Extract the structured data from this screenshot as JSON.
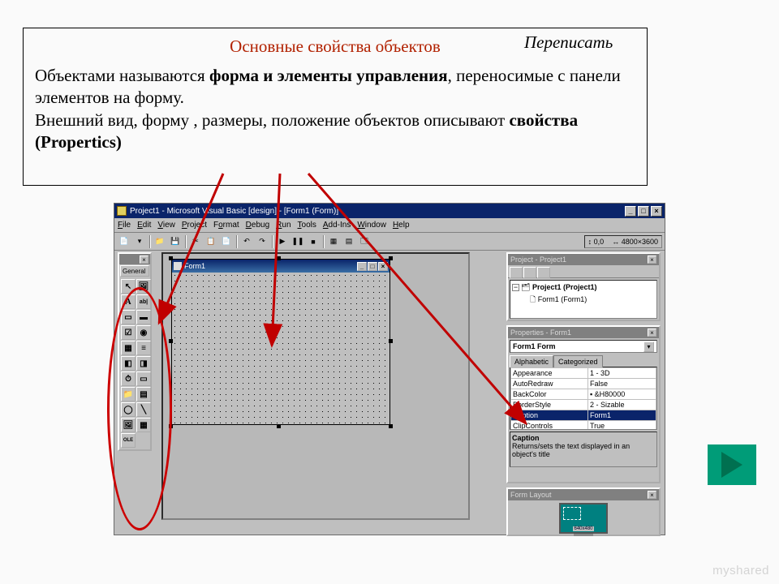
{
  "callout": {
    "heading": "Основные свойства объектов",
    "rewrite": "Переписать",
    "line1_pre": "Объектами называются ",
    "line1_bold": "форма и элементы управления",
    "line1_post": ", переносимые с панели элементов на форму.",
    "line2": "Внешний вид, форму , размеры, положение объектов описывают ",
    "line2_bold": "свойства (Propertics)"
  },
  "ide": {
    "title": "Project1 - Microsoft Visual Basic [design] - [Form1 (Form)]",
    "menubar": [
      "File",
      "Edit",
      "View",
      "Project",
      "Format",
      "Debug",
      "Run",
      "Tools",
      "Add-Ins",
      "Window",
      "Help"
    ],
    "toolbox_title": "",
    "toolbox_tab": "General",
    "form_title": "Form1",
    "project_panel": {
      "title": "Project - Project1",
      "root": "Project1 (Project1)",
      "child": "Form1 (Form1)"
    },
    "properties_panel": {
      "title": "Properties - Form1",
      "combo": "Form1 Form",
      "tabs": [
        "Alphabetic",
        "Categorized"
      ],
      "rows": [
        {
          "name": "Appearance",
          "value": "1 - 3D"
        },
        {
          "name": "AutoRedraw",
          "value": "False"
        },
        {
          "name": "BackColor",
          "value": "&H80000"
        },
        {
          "name": "BorderStyle",
          "value": "2 - Sizable"
        },
        {
          "name": "Caption",
          "value": "Form1",
          "selected": true
        },
        {
          "name": "ClipControls",
          "value": "True"
        }
      ],
      "desc_title": "Caption",
      "desc_body": "Returns/sets the text displayed in an object's title"
    },
    "layout_panel": {
      "title": "Form Layout",
      "label": "640x480"
    },
    "tools": [
      "▸",
      "🖼",
      "A",
      "ab|",
      "▭",
      "☐",
      "☑",
      "◉",
      "▦",
      "≡",
      "⫿",
      "⫿",
      "⏱",
      "▭",
      "📁",
      "▭",
      "▤",
      "🖼",
      "O̲LE"
    ]
  },
  "watermark": "myshared"
}
